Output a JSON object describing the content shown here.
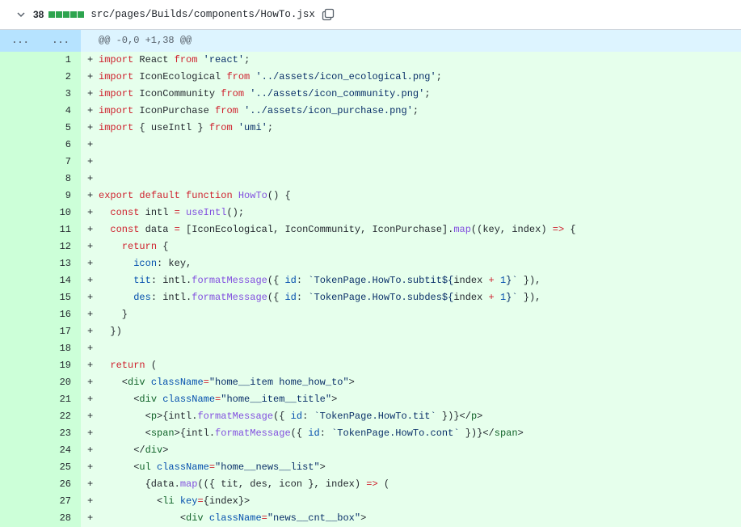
{
  "file": {
    "additions": "38",
    "diffstat_blocks": 5,
    "path": "src/pages/Builds/components/HowTo.jsx"
  },
  "hunk": {
    "left_expander": "...",
    "right_expander": "...",
    "header": "@@ -0,0 +1,38 @@"
  },
  "colors": {
    "added_bg": "#e6ffec",
    "added_gutter": "#ccffd8",
    "hunk_bg": "#ddf4ff",
    "diffstat_green": "#2da44e"
  },
  "lines": [
    {
      "n": "1",
      "tokens": [
        [
          "k",
          "import"
        ],
        [
          "p",
          " React "
        ],
        [
          "k",
          "from"
        ],
        [
          "p",
          " "
        ],
        [
          "s",
          "'react'"
        ],
        [
          "p",
          ";"
        ]
      ]
    },
    {
      "n": "2",
      "tokens": [
        [
          "k",
          "import"
        ],
        [
          "p",
          " IconEcological "
        ],
        [
          "k",
          "from"
        ],
        [
          "p",
          " "
        ],
        [
          "s",
          "'../assets/icon_ecological.png'"
        ],
        [
          "p",
          ";"
        ]
      ]
    },
    {
      "n": "3",
      "tokens": [
        [
          "k",
          "import"
        ],
        [
          "p",
          " IconCommunity "
        ],
        [
          "k",
          "from"
        ],
        [
          "p",
          " "
        ],
        [
          "s",
          "'../assets/icon_community.png'"
        ],
        [
          "p",
          ";"
        ]
      ]
    },
    {
      "n": "4",
      "tokens": [
        [
          "k",
          "import"
        ],
        [
          "p",
          " IconPurchase "
        ],
        [
          "k",
          "from"
        ],
        [
          "p",
          " "
        ],
        [
          "s",
          "'../assets/icon_purchase.png'"
        ],
        [
          "p",
          ";"
        ]
      ]
    },
    {
      "n": "5",
      "tokens": [
        [
          "k",
          "import"
        ],
        [
          "p",
          " { useIntl } "
        ],
        [
          "k",
          "from"
        ],
        [
          "p",
          " "
        ],
        [
          "s",
          "'umi'"
        ],
        [
          "p",
          ";"
        ]
      ]
    },
    {
      "n": "6",
      "tokens": []
    },
    {
      "n": "7",
      "tokens": []
    },
    {
      "n": "8",
      "tokens": []
    },
    {
      "n": "9",
      "tokens": [
        [
          "k",
          "export"
        ],
        [
          "p",
          " "
        ],
        [
          "k",
          "default"
        ],
        [
          "p",
          " "
        ],
        [
          "k",
          "function"
        ],
        [
          "p",
          " "
        ],
        [
          "f",
          "HowTo"
        ],
        [
          "p",
          "() {"
        ]
      ]
    },
    {
      "n": "10",
      "tokens": [
        [
          "p",
          "  "
        ],
        [
          "k",
          "const"
        ],
        [
          "p",
          " intl "
        ],
        [
          "k",
          "="
        ],
        [
          "p",
          " "
        ],
        [
          "f",
          "useIntl"
        ],
        [
          "p",
          "();"
        ]
      ]
    },
    {
      "n": "11",
      "tokens": [
        [
          "p",
          "  "
        ],
        [
          "k",
          "const"
        ],
        [
          "p",
          " data "
        ],
        [
          "k",
          "="
        ],
        [
          "p",
          " [IconEcological, IconCommunity, IconPurchase]."
        ],
        [
          "f",
          "map"
        ],
        [
          "p",
          "((key, index) "
        ],
        [
          "k",
          "=>"
        ],
        [
          "p",
          " {"
        ]
      ]
    },
    {
      "n": "12",
      "tokens": [
        [
          "p",
          "    "
        ],
        [
          "k",
          "return"
        ],
        [
          "p",
          " {"
        ]
      ]
    },
    {
      "n": "13",
      "tokens": [
        [
          "p",
          "      "
        ],
        [
          "c",
          "icon"
        ],
        [
          "p",
          ": key,"
        ]
      ]
    },
    {
      "n": "14",
      "tokens": [
        [
          "p",
          "      "
        ],
        [
          "c",
          "tit"
        ],
        [
          "p",
          ": intl."
        ],
        [
          "f",
          "formatMessage"
        ],
        [
          "p",
          "({ "
        ],
        [
          "c",
          "id"
        ],
        [
          "p",
          ": "
        ],
        [
          "s",
          "`TokenPage.HowTo.subtit${"
        ],
        [
          "p",
          "index "
        ],
        [
          "k",
          "+"
        ],
        [
          "p",
          " "
        ],
        [
          "c",
          "1"
        ],
        [
          "s",
          "}`"
        ],
        [
          "p",
          " }),"
        ]
      ]
    },
    {
      "n": "15",
      "tokens": [
        [
          "p",
          "      "
        ],
        [
          "c",
          "des"
        ],
        [
          "p",
          ": intl."
        ],
        [
          "f",
          "formatMessage"
        ],
        [
          "p",
          "({ "
        ],
        [
          "c",
          "id"
        ],
        [
          "p",
          ": "
        ],
        [
          "s",
          "`TokenPage.HowTo.subdes${"
        ],
        [
          "p",
          "index "
        ],
        [
          "k",
          "+"
        ],
        [
          "p",
          " "
        ],
        [
          "c",
          "1"
        ],
        [
          "s",
          "}`"
        ],
        [
          "p",
          " }),"
        ]
      ]
    },
    {
      "n": "16",
      "tokens": [
        [
          "p",
          "    }"
        ]
      ]
    },
    {
      "n": "17",
      "tokens": [
        [
          "p",
          "  })"
        ]
      ]
    },
    {
      "n": "18",
      "tokens": []
    },
    {
      "n": "19",
      "tokens": [
        [
          "p",
          "  "
        ],
        [
          "k",
          "return"
        ],
        [
          "p",
          " ("
        ]
      ]
    },
    {
      "n": "20",
      "tokens": [
        [
          "p",
          "    <"
        ],
        [
          "t",
          "div"
        ],
        [
          "p",
          " "
        ],
        [
          "c",
          "className"
        ],
        [
          "k",
          "="
        ],
        [
          "s",
          "\"home__item home_how_to\""
        ],
        [
          "p",
          ">"
        ]
      ]
    },
    {
      "n": "21",
      "tokens": [
        [
          "p",
          "      <"
        ],
        [
          "t",
          "div"
        ],
        [
          "p",
          " "
        ],
        [
          "c",
          "className"
        ],
        [
          "k",
          "="
        ],
        [
          "s",
          "\"home__item__title\""
        ],
        [
          "p",
          ">"
        ]
      ]
    },
    {
      "n": "22",
      "tokens": [
        [
          "p",
          "        <"
        ],
        [
          "t",
          "p"
        ],
        [
          "p",
          ">{intl."
        ],
        [
          "f",
          "formatMessage"
        ],
        [
          "p",
          "({ "
        ],
        [
          "c",
          "id"
        ],
        [
          "p",
          ": "
        ],
        [
          "s",
          "`TokenPage.HowTo.tit`"
        ],
        [
          "p",
          " })}</"
        ],
        [
          "t",
          "p"
        ],
        [
          "p",
          ">"
        ]
      ]
    },
    {
      "n": "23",
      "tokens": [
        [
          "p",
          "        <"
        ],
        [
          "t",
          "span"
        ],
        [
          "p",
          ">{intl."
        ],
        [
          "f",
          "formatMessage"
        ],
        [
          "p",
          "({ "
        ],
        [
          "c",
          "id"
        ],
        [
          "p",
          ": "
        ],
        [
          "s",
          "`TokenPage.HowTo.cont`"
        ],
        [
          "p",
          " })}</"
        ],
        [
          "t",
          "span"
        ],
        [
          "p",
          ">"
        ]
      ]
    },
    {
      "n": "24",
      "tokens": [
        [
          "p",
          "      </"
        ],
        [
          "t",
          "div"
        ],
        [
          "p",
          ">"
        ]
      ]
    },
    {
      "n": "25",
      "tokens": [
        [
          "p",
          "      <"
        ],
        [
          "t",
          "ul"
        ],
        [
          "p",
          " "
        ],
        [
          "c",
          "className"
        ],
        [
          "k",
          "="
        ],
        [
          "s",
          "\"home__news__list\""
        ],
        [
          "p",
          ">"
        ]
      ]
    },
    {
      "n": "26",
      "tokens": [
        [
          "p",
          "        {data."
        ],
        [
          "f",
          "map"
        ],
        [
          "p",
          "(({ tit, des, icon }, index) "
        ],
        [
          "k",
          "=>"
        ],
        [
          "p",
          " ("
        ]
      ]
    },
    {
      "n": "27",
      "tokens": [
        [
          "p",
          "          <"
        ],
        [
          "t",
          "li"
        ],
        [
          "p",
          " "
        ],
        [
          "c",
          "key"
        ],
        [
          "k",
          "="
        ],
        [
          "p",
          "{index}>"
        ]
      ]
    },
    {
      "n": "28",
      "tokens": [
        [
          "p",
          "              <"
        ],
        [
          "t",
          "div"
        ],
        [
          "p",
          " "
        ],
        [
          "c",
          "className"
        ],
        [
          "k",
          "="
        ],
        [
          "s",
          "\"news__cnt__box\""
        ],
        [
          "p",
          ">"
        ]
      ]
    }
  ]
}
